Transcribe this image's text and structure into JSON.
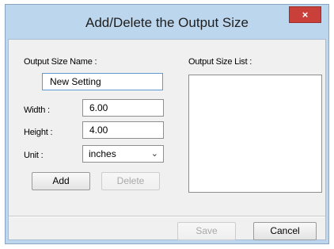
{
  "window": {
    "title": "Add/Delete the Output Size",
    "close_glyph": "×"
  },
  "form": {
    "name_label": "Output Size Name :",
    "name_value": "New Setting",
    "width_label": "Width :",
    "width_value": "6.00",
    "height_label": "Height :",
    "height_value": "4.00",
    "unit_label": "Unit :",
    "unit_value": "inches",
    "add_label": "Add",
    "delete_label": "Delete"
  },
  "list": {
    "label": "Output Size List :",
    "items": []
  },
  "footer": {
    "save_label": "Save",
    "cancel_label": "Cancel"
  },
  "colors": {
    "title_bg": "#bcd6ee",
    "close_bg": "#c9403a",
    "client_bg": "#f0f0f0"
  }
}
